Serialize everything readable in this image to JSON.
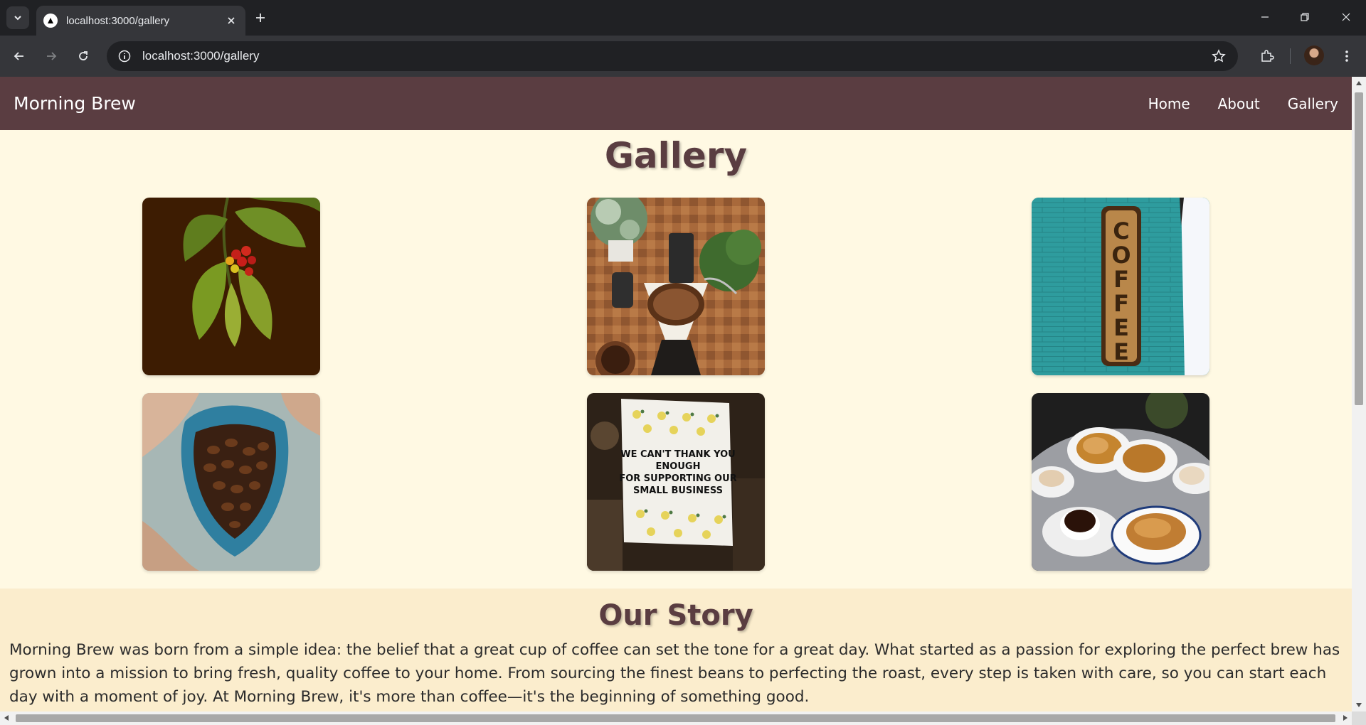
{
  "browser": {
    "tab_title": "localhost:3000/gallery",
    "url": "localhost:3000/gallery"
  },
  "site": {
    "brand": "Morning Brew",
    "nav": [
      {
        "label": "Home"
      },
      {
        "label": "About"
      },
      {
        "label": "Gallery"
      }
    ]
  },
  "gallery": {
    "title": "Gallery",
    "photos": [
      {
        "subject": "coffee-plant-with-cherries"
      },
      {
        "subject": "pour-over-coffee"
      },
      {
        "subject": "coffee-sign-on-teal-wall"
      },
      {
        "subject": "bag-of-coffee-beans"
      },
      {
        "subject": "thank-you-sign",
        "sign_lines": [
          "WE CAN'T THANK YOU",
          "ENOUGH",
          "FOR SUPPORTING OUR",
          "SMALL BUSINESS"
        ]
      },
      {
        "subject": "coffee-and-croissants"
      }
    ],
    "coffee_sign_letters": "COFFEE"
  },
  "story": {
    "title": "Our Story",
    "text": "Morning Brew was born from a simple idea: the belief that a great cup of coffee can set the tone for a great day. What started as a passion for exploring the perfect brew has grown into a mission to bring fresh, quality coffee to your home. From sourcing the finest beans to perfecting the roast, every step is taken with care, so you can start each day with a moment of joy. At Morning Brew, it's more than coffee—it's the beginning of something good."
  },
  "colors": {
    "nav_bg": "#5a3d41",
    "page_bg": "#fff9e3",
    "story_bg": "#fbedcd",
    "heading": "#5a3d41"
  }
}
